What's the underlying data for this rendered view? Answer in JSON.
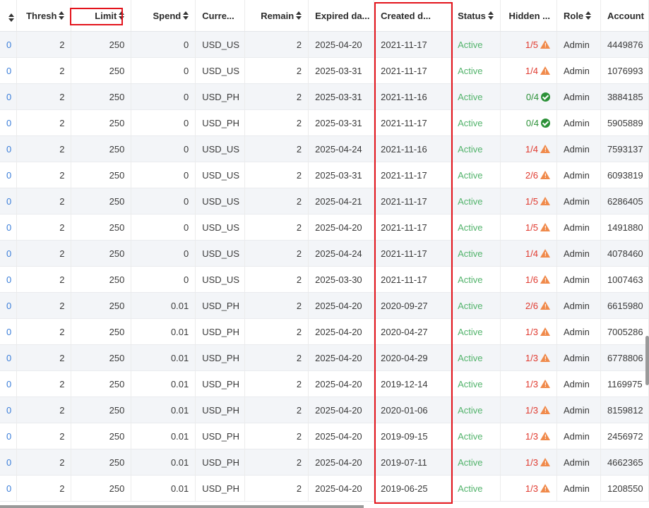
{
  "columns": [
    {
      "key": "c0",
      "label": "",
      "sortable": true
    },
    {
      "key": "thresh",
      "label": "Thresh",
      "sortable": true
    },
    {
      "key": "limit",
      "label": "Limit",
      "sortable": true
    },
    {
      "key": "spend",
      "label": "Spend",
      "sortable": true
    },
    {
      "key": "currency",
      "label": "Curre...",
      "sortable": false
    },
    {
      "key": "remain",
      "label": "Remain",
      "sortable": true
    },
    {
      "key": "expired",
      "label": "Expired da...",
      "sortable": false
    },
    {
      "key": "created",
      "label": "Created d...",
      "sortable": false
    },
    {
      "key": "status",
      "label": "Status",
      "sortable": true
    },
    {
      "key": "hidden",
      "label": "Hidden ...",
      "sortable": false
    },
    {
      "key": "role",
      "label": "Role",
      "sortable": true
    },
    {
      "key": "account",
      "label": "Account",
      "sortable": false
    }
  ],
  "rows": [
    {
      "c0": "0",
      "thresh": "2",
      "limit": "250",
      "spend": "0",
      "currency": "USD_US",
      "remain": "2",
      "expired": "2025-04-20",
      "created": "2021-11-17",
      "status": "Active",
      "hidden": "1/5",
      "hidden_state": "warn",
      "role": "Admin",
      "account": "4449876"
    },
    {
      "c0": "0",
      "thresh": "2",
      "limit": "250",
      "spend": "0",
      "currency": "USD_US",
      "remain": "2",
      "expired": "2025-03-31",
      "created": "2021-11-17",
      "status": "Active",
      "hidden": "1/4",
      "hidden_state": "warn",
      "role": "Admin",
      "account": "1076993"
    },
    {
      "c0": "0",
      "thresh": "2",
      "limit": "250",
      "spend": "0",
      "currency": "USD_PH",
      "remain": "2",
      "expired": "2025-03-31",
      "created": "2021-11-16",
      "status": "Active",
      "hidden": "0/4",
      "hidden_state": "ok",
      "role": "Admin",
      "account": "3884185"
    },
    {
      "c0": "0",
      "thresh": "2",
      "limit": "250",
      "spend": "0",
      "currency": "USD_PH",
      "remain": "2",
      "expired": "2025-03-31",
      "created": "2021-11-17",
      "status": "Active",
      "hidden": "0/4",
      "hidden_state": "ok",
      "role": "Admin",
      "account": "5905889"
    },
    {
      "c0": "0",
      "thresh": "2",
      "limit": "250",
      "spend": "0",
      "currency": "USD_US",
      "remain": "2",
      "expired": "2025-04-24",
      "created": "2021-11-16",
      "status": "Active",
      "hidden": "1/4",
      "hidden_state": "warn",
      "role": "Admin",
      "account": "7593137"
    },
    {
      "c0": "0",
      "thresh": "2",
      "limit": "250",
      "spend": "0",
      "currency": "USD_US",
      "remain": "2",
      "expired": "2025-03-31",
      "created": "2021-11-17",
      "status": "Active",
      "hidden": "2/6",
      "hidden_state": "warn",
      "role": "Admin",
      "account": "6093819"
    },
    {
      "c0": "0",
      "thresh": "2",
      "limit": "250",
      "spend": "0",
      "currency": "USD_US",
      "remain": "2",
      "expired": "2025-04-21",
      "created": "2021-11-17",
      "status": "Active",
      "hidden": "1/5",
      "hidden_state": "warn",
      "role": "Admin",
      "account": "6286405"
    },
    {
      "c0": "0",
      "thresh": "2",
      "limit": "250",
      "spend": "0",
      "currency": "USD_US",
      "remain": "2",
      "expired": "2025-04-20",
      "created": "2021-11-17",
      "status": "Active",
      "hidden": "1/5",
      "hidden_state": "warn",
      "role": "Admin",
      "account": "1491880"
    },
    {
      "c0": "0",
      "thresh": "2",
      "limit": "250",
      "spend": "0",
      "currency": "USD_US",
      "remain": "2",
      "expired": "2025-04-24",
      "created": "2021-11-17",
      "status": "Active",
      "hidden": "1/4",
      "hidden_state": "warn",
      "role": "Admin",
      "account": "4078460"
    },
    {
      "c0": "0",
      "thresh": "2",
      "limit": "250",
      "spend": "0",
      "currency": "USD_US",
      "remain": "2",
      "expired": "2025-03-30",
      "created": "2021-11-17",
      "status": "Active",
      "hidden": "1/6",
      "hidden_state": "warn",
      "role": "Admin",
      "account": "1007463"
    },
    {
      "c0": "0",
      "thresh": "2",
      "limit": "250",
      "spend": "0.01",
      "currency": "USD_PH",
      "remain": "2",
      "expired": "2025-04-20",
      "created": "2020-09-27",
      "status": "Active",
      "hidden": "2/6",
      "hidden_state": "warn",
      "role": "Admin",
      "account": "6615980"
    },
    {
      "c0": "0",
      "thresh": "2",
      "limit": "250",
      "spend": "0.01",
      "currency": "USD_PH",
      "remain": "2",
      "expired": "2025-04-20",
      "created": "2020-04-27",
      "status": "Active",
      "hidden": "1/3",
      "hidden_state": "warn",
      "role": "Admin",
      "account": "7005286"
    },
    {
      "c0": "0",
      "thresh": "2",
      "limit": "250",
      "spend": "0.01",
      "currency": "USD_PH",
      "remain": "2",
      "expired": "2025-04-20",
      "created": "2020-04-29",
      "status": "Active",
      "hidden": "1/3",
      "hidden_state": "warn",
      "role": "Admin",
      "account": "6778806"
    },
    {
      "c0": "0",
      "thresh": "2",
      "limit": "250",
      "spend": "0.01",
      "currency": "USD_PH",
      "remain": "2",
      "expired": "2025-04-20",
      "created": "2019-12-14",
      "status": "Active",
      "hidden": "1/3",
      "hidden_state": "warn",
      "role": "Admin",
      "account": "1169975"
    },
    {
      "c0": "0",
      "thresh": "2",
      "limit": "250",
      "spend": "0.01",
      "currency": "USD_PH",
      "remain": "2",
      "expired": "2025-04-20",
      "created": "2020-01-06",
      "status": "Active",
      "hidden": "1/3",
      "hidden_state": "warn",
      "role": "Admin",
      "account": "8159812"
    },
    {
      "c0": "0",
      "thresh": "2",
      "limit": "250",
      "spend": "0.01",
      "currency": "USD_PH",
      "remain": "2",
      "expired": "2025-04-20",
      "created": "2019-09-15",
      "status": "Active",
      "hidden": "1/3",
      "hidden_state": "warn",
      "role": "Admin",
      "account": "2456972"
    },
    {
      "c0": "0",
      "thresh": "2",
      "limit": "250",
      "spend": "0.01",
      "currency": "USD_PH",
      "remain": "2",
      "expired": "2025-04-20",
      "created": "2019-07-11",
      "status": "Active",
      "hidden": "1/3",
      "hidden_state": "warn",
      "role": "Admin",
      "account": "4662365"
    },
    {
      "c0": "0",
      "thresh": "2",
      "limit": "250",
      "spend": "0.01",
      "currency": "USD_PH",
      "remain": "2",
      "expired": "2025-04-20",
      "created": "2019-06-25",
      "status": "Active",
      "hidden": "1/3",
      "hidden_state": "warn",
      "role": "Admin",
      "account": "1208550"
    }
  ],
  "colors": {
    "link": "#3b7ed9",
    "active": "#52b36b",
    "warning": "#e03a2f",
    "ok": "#2c9138",
    "highlight": "#e3141c"
  }
}
